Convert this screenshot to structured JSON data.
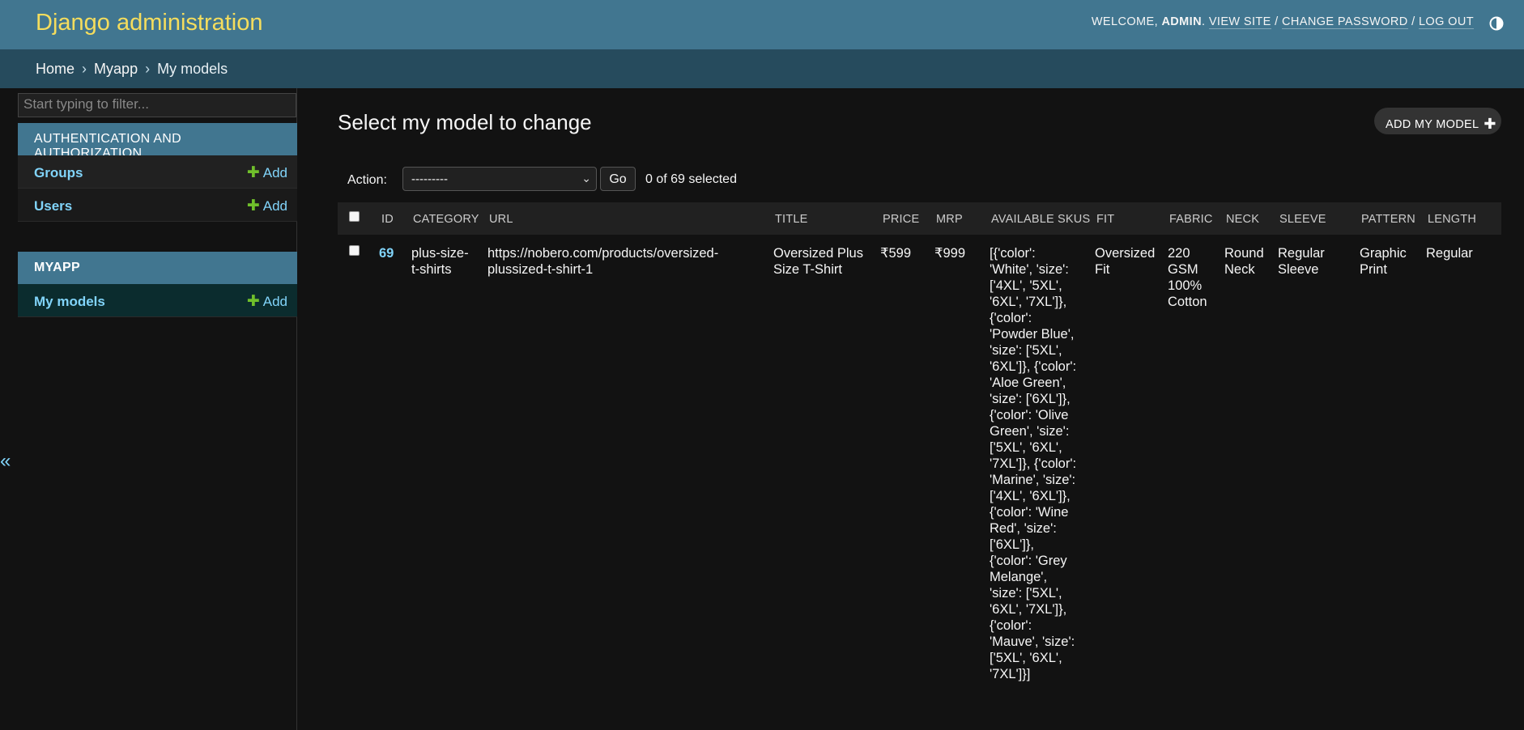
{
  "header": {
    "brand": "Django administration",
    "welcome": "Welcome,",
    "username": "admin",
    "view_site": "View site",
    "change_password": "Change password",
    "log_out": "Log out",
    "theme_icon": "contrast-icon"
  },
  "breadcrumbs": {
    "home": "Home",
    "app": "Myapp",
    "current": "My models",
    "separator": "›"
  },
  "sidebar": {
    "filter_placeholder": "Start typing to filter...",
    "modules": [
      {
        "caption": "Authentication and Authorization",
        "models": [
          {
            "label": "Groups",
            "add": "Add"
          },
          {
            "label": "Users",
            "add": "Add"
          }
        ]
      },
      {
        "caption": "Myapp",
        "models": [
          {
            "label": "My models",
            "add": "Add"
          }
        ]
      }
    ],
    "collapse": "«"
  },
  "content": {
    "title": "Select my model to change",
    "add_button": "Add my model",
    "actions": {
      "label": "Action:",
      "selected_option": "---------",
      "go": "Go",
      "counter": "0 of 69 selected"
    },
    "columns": [
      "ID",
      "Category",
      "URL",
      "Title",
      "Price",
      "MRP",
      "Available SKUs",
      "Fit",
      "Fabric",
      "Neck",
      "Sleeve",
      "Pattern",
      "Length"
    ],
    "rows": [
      {
        "id": "69",
        "category": "plus-size-t-shirts",
        "url": "https://nobero.com/products/oversized-plussized-t-shirt-1",
        "title": "Oversized Plus Size T-Shirt",
        "price": "₹599",
        "mrp": "₹999",
        "available_skus": "[{'color': 'White', 'size': ['4XL', '5XL', '6XL', '7XL']}, {'color': 'Powder Blue', 'size': ['5XL', '6XL']}, {'color': 'Aloe Green', 'size': ['6XL']}, {'color': 'Olive Green', 'size': ['5XL', '6XL', '7XL']}, {'color': 'Marine', 'size': ['4XL', '6XL']}, {'color': 'Wine Red', 'size': ['6XL']}, {'color': 'Grey Melange', 'size': ['5XL', '6XL', '7XL']}, {'color': 'Mauve', 'size': ['5XL', '6XL', '7XL']}]",
        "fit": "Oversized Fit",
        "fabric": "220 GSM 100% Cotton",
        "neck": "Round Neck",
        "sleeve": "Regular Sleeve",
        "pattern": "Graphic Print",
        "length": "Regular"
      }
    ]
  }
}
